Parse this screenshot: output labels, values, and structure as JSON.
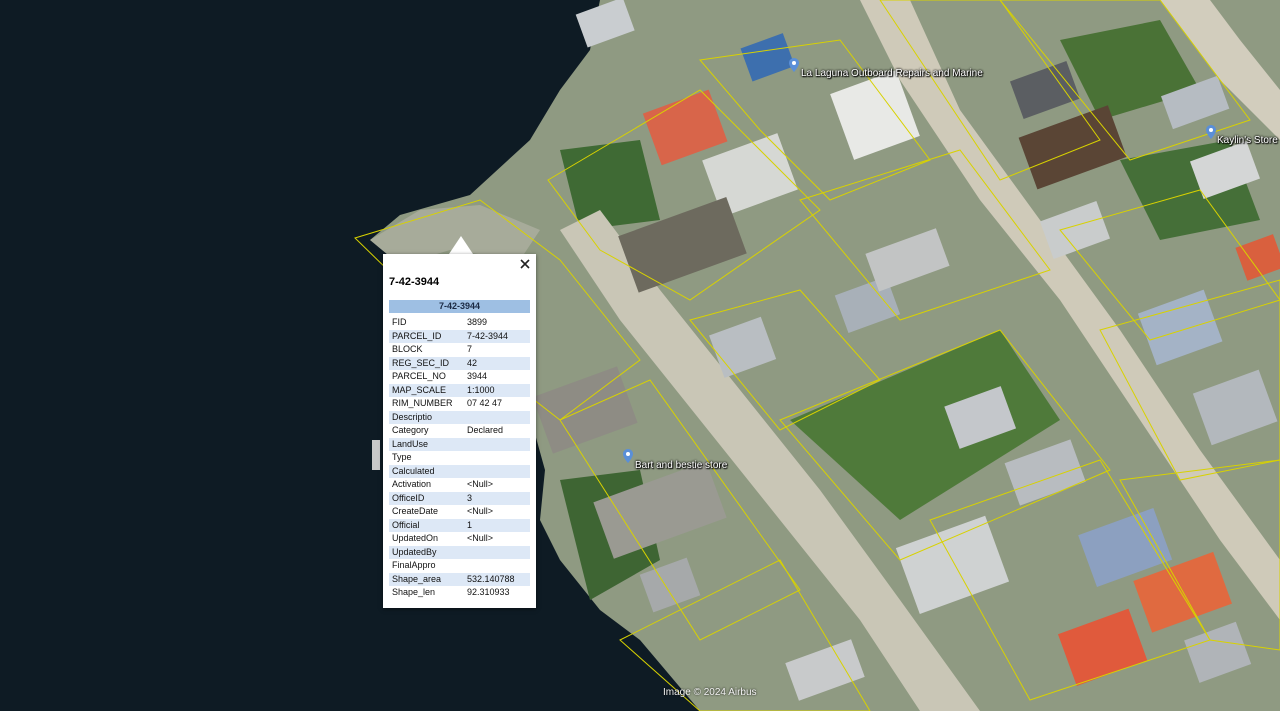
{
  "map": {
    "places": [
      {
        "name": "La Laguna Outboard Repairs and Marine"
      },
      {
        "name": "Kaylin's Store"
      },
      {
        "name": "Bart and bestie store"
      }
    ],
    "attribution": "Image © 2024 Airbus"
  },
  "popup": {
    "title": "7-42-3944",
    "header": "7-42-3944",
    "close_icon": "close-icon",
    "rows": [
      {
        "key": "FID",
        "value": "3899"
      },
      {
        "key": "PARCEL_ID",
        "value": "7-42-3944"
      },
      {
        "key": "BLOCK",
        "value": "7"
      },
      {
        "key": "REG_SEC_ID",
        "value": "42"
      },
      {
        "key": "PARCEL_NO",
        "value": "3944"
      },
      {
        "key": "MAP_SCALE",
        "value": "1:1000"
      },
      {
        "key": "RIM_NUMBER",
        "value": "07 42 47"
      },
      {
        "key": "Descriptio",
        "value": ""
      },
      {
        "key": "Category",
        "value": "Declared"
      },
      {
        "key": "LandUse",
        "value": ""
      },
      {
        "key": "Type",
        "value": ""
      },
      {
        "key": "Calculated",
        "value": ""
      },
      {
        "key": "Activation",
        "value": "<Null>"
      },
      {
        "key": "OfficeID",
        "value": "3"
      },
      {
        "key": "CreateDate",
        "value": "<Null>"
      },
      {
        "key": "Official",
        "value": "1"
      },
      {
        "key": "UpdatedOn",
        "value": "<Null>"
      },
      {
        "key": "UpdatedBy",
        "value": ""
      },
      {
        "key": "FinalAppro",
        "value": ""
      },
      {
        "key": "Shape_area",
        "value": "532.140788"
      },
      {
        "key": "Shape_len",
        "value": "92.310933"
      }
    ]
  }
}
